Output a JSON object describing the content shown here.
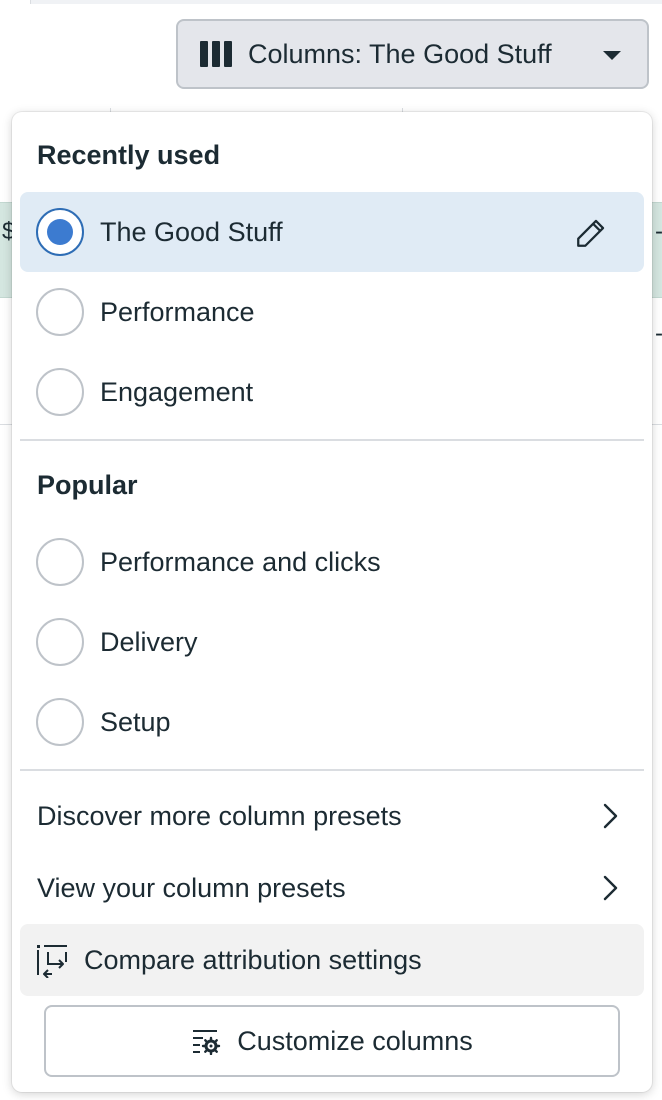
{
  "toolbar": {
    "columns_button_label": "Columns: The Good Stuff",
    "columns_icon": "columns-icon",
    "caret_icon": "caret-down-icon"
  },
  "background": {
    "edge_left_text": "$",
    "edge_right_text_1": "-",
    "edge_right_text_2": "-"
  },
  "dropdown": {
    "recently_used": {
      "heading": "Recently used",
      "options": [
        {
          "label": "The Good Stuff",
          "selected": true,
          "editable": true
        },
        {
          "label": "Performance",
          "selected": false
        },
        {
          "label": "Engagement",
          "selected": false
        }
      ]
    },
    "popular": {
      "heading": "Popular",
      "options": [
        {
          "label": "Performance and clicks",
          "selected": false
        },
        {
          "label": "Delivery",
          "selected": false
        },
        {
          "label": "Setup",
          "selected": false
        }
      ]
    },
    "links": {
      "discover": "Discover more column presets",
      "view": "View your column presets",
      "compare": "Compare attribution settings"
    },
    "customize_button_label": "Customize columns"
  },
  "colors": {
    "selected_row_bg": "#e0ebf5",
    "radio_checked": "#3c7bd0",
    "text": "#1c2b33",
    "highlight_row": "#d4e6e0"
  }
}
